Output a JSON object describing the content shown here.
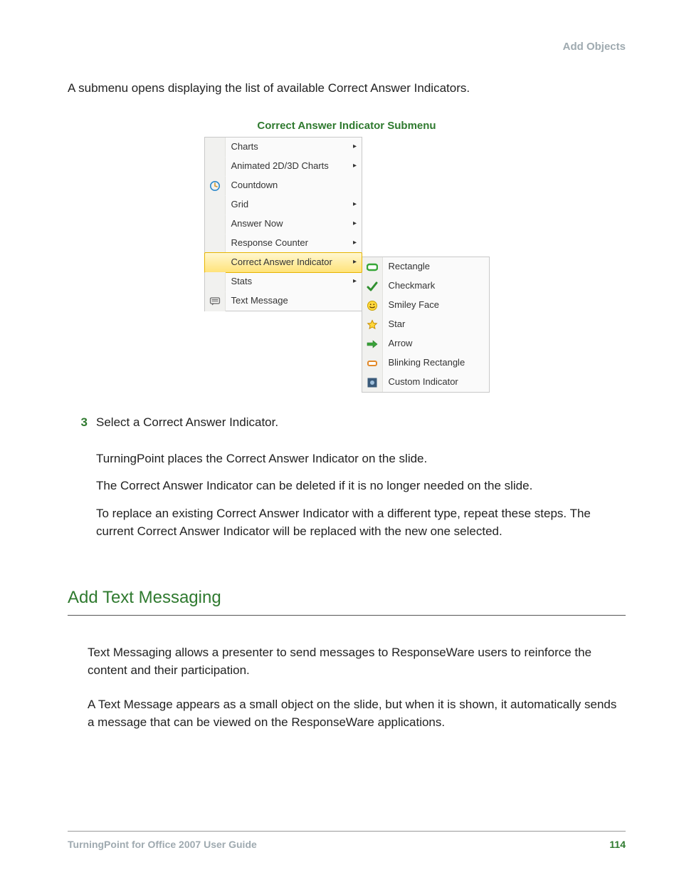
{
  "header": {
    "section": "Add Objects"
  },
  "intro": "A submenu opens displaying the list of available Correct Answer Indicators.",
  "figure": {
    "caption": "Correct Answer Indicator Submenu",
    "main_menu": [
      {
        "label": "Charts",
        "icon": "",
        "arrow": true
      },
      {
        "label": "Animated 2D/3D Charts",
        "icon": "",
        "arrow": true
      },
      {
        "label": "Countdown",
        "icon": "clock",
        "arrow": false
      },
      {
        "label": "Grid",
        "icon": "",
        "arrow": true
      },
      {
        "label": "Answer Now",
        "icon": "",
        "arrow": true
      },
      {
        "label": "Response Counter",
        "icon": "",
        "arrow": true
      },
      {
        "label": "Correct Answer Indicator",
        "icon": "",
        "arrow": true,
        "highlight": true
      },
      {
        "label": "Stats",
        "icon": "",
        "arrow": true
      },
      {
        "label": "Text Message",
        "icon": "textmsg",
        "arrow": false
      }
    ],
    "sub_menu": [
      {
        "label": "Rectangle",
        "icon": "rect"
      },
      {
        "label": "Checkmark",
        "icon": "check"
      },
      {
        "label": "Smiley Face",
        "icon": "smiley"
      },
      {
        "label": "Star",
        "icon": "star"
      },
      {
        "label": "Arrow",
        "icon": "arrow"
      },
      {
        "label": "Blinking Rectangle",
        "icon": "brect"
      },
      {
        "label": "Custom Indicator",
        "icon": "custom"
      }
    ]
  },
  "step": {
    "number": "3",
    "lines": [
      "Select a Correct Answer Indicator.",
      "TurningPoint places the Correct Answer Indicator on the slide.",
      "The Correct Answer Indicator can be deleted if it is no longer needed on the slide.",
      "To replace an existing Correct Answer Indicator with a different type, repeat these steps. The current Correct Answer Indicator will be replaced with the new one selected."
    ]
  },
  "heading": "Add Text Messaging",
  "section_paras": [
    "Text Messaging allows a presenter to send messages to ResponseWare users to reinforce the content and their participation.",
    " A Text Message appears as a small object on the slide, but when it is shown, it automatically sends a message that can be viewed on the ResponseWare applications."
  ],
  "footer": {
    "title": "TurningPoint for Office 2007 User Guide",
    "page": "114"
  }
}
